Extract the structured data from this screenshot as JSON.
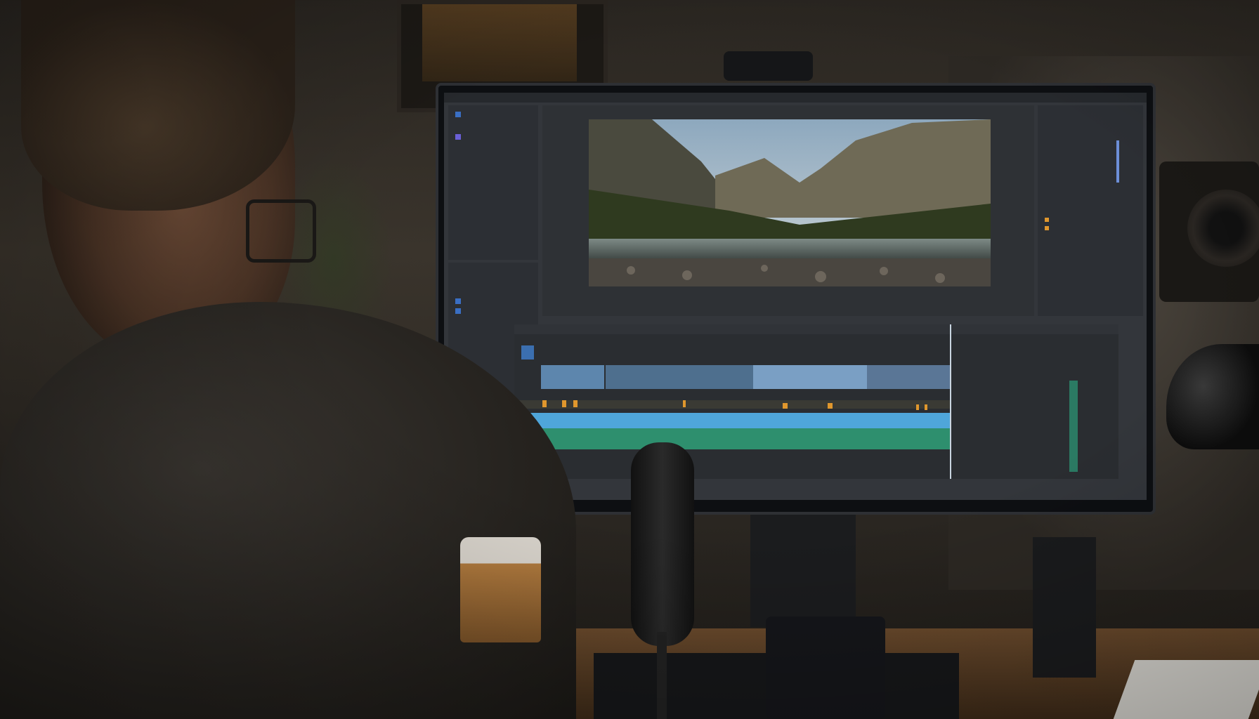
{
  "scene": {
    "description_icons": {
      "app": "video-editor",
      "viewer": "mountain-lake-image"
    }
  },
  "editor": {
    "viewer_caption": "",
    "timeline_markers": 8
  }
}
